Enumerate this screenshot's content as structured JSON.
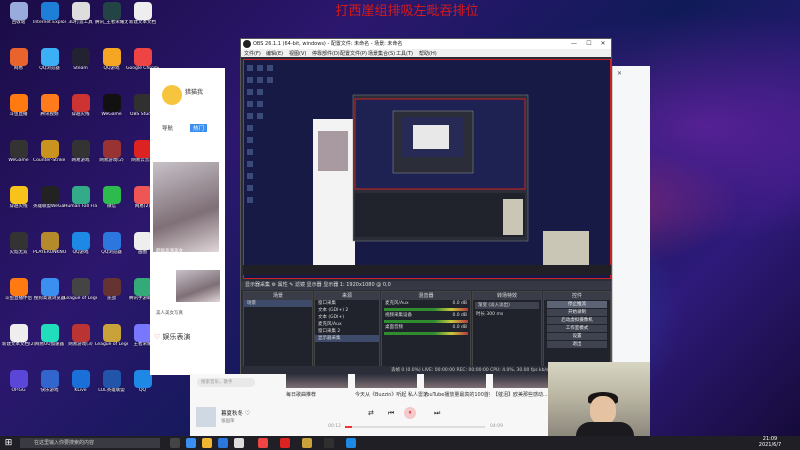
{
  "overlay_title": "打西崖组排吸左毗吞排位",
  "desktop_icons": [
    {
      "label": "回收站",
      "color": "#9ad"
    },
    {
      "label": "Internet Explorer",
      "color": "#1e7fd8"
    },
    {
      "label": "3D打造工具",
      "color": "#ddd"
    },
    {
      "label": "腾讯_王者荣耀无限火力",
      "color": "#244"
    },
    {
      "label": "新建文本文档",
      "color": "#eee"
    },
    {
      "label": "网易",
      "color": "#e8642c"
    },
    {
      "label": "QQ浏览器",
      "color": "#3bb0f6"
    },
    {
      "label": "Steam",
      "color": "#223"
    },
    {
      "label": "QQ游戏",
      "color": "#f5a623"
    },
    {
      "label": "Google Chrome",
      "color": "#e44"
    },
    {
      "label": "斗鱼直播",
      "color": "#ff7a10"
    },
    {
      "label": "腾讯视频",
      "color": "#ff7b1c"
    },
    {
      "label": "穿越火线",
      "color": "#c33"
    },
    {
      "label": "WeGame",
      "color": "#111"
    },
    {
      "label": "OBS Studio",
      "color": "#303030"
    },
    {
      "label": "WeGame",
      "color": "#333"
    },
    {
      "label": "Counter-Strike Global Off...",
      "color": "#c8931f"
    },
    {
      "label": "网易游戏",
      "color": "#333"
    },
    {
      "label": "网易游戏(2)",
      "color": "#933"
    },
    {
      "label": "网易云音乐",
      "color": "#d22"
    },
    {
      "label": "穿越火线",
      "color": "#f7c31a"
    },
    {
      "label": "英雄联盟WeGame版",
      "color": "#222"
    },
    {
      "label": "Human Fall Flat",
      "color": "#3a8"
    },
    {
      "label": "微信",
      "color": "#2dbb4e"
    },
    {
      "label": "网易(2)",
      "color": "#e55"
    },
    {
      "label": "火焰无双",
      "color": "#333"
    },
    {
      "label": "PLAYERUNKNOWN'S BATTLEGR...",
      "color": "#b58a2c"
    },
    {
      "label": "QQ游戏",
      "color": "#1e88e5"
    },
    {
      "label": "QQ浏览器",
      "color": "#2c77dd"
    },
    {
      "label": "画图",
      "color": "#eee"
    },
    {
      "label": "斗鱼直播伴侣",
      "color": "#ff7a10"
    },
    {
      "label": "搜狗高速浏览器",
      "color": "#3a8ff0"
    },
    {
      "label": "League of Legends",
      "color": "#444"
    },
    {
      "label": "逆战",
      "color": "#633"
    },
    {
      "label": "腾讯手游助手",
      "color": "#3a7"
    },
    {
      "label": "新建文本文档(2)",
      "color": "#eee"
    },
    {
      "label": "网易UU加速器",
      "color": "#2db"
    },
    {
      "label": "网易游戏(3)",
      "color": "#b33"
    },
    {
      "label": "League of Legends",
      "color": "#c9a33a"
    },
    {
      "label": "王者荣耀",
      "color": "#77f"
    },
    {
      "label": "OP.GG",
      "color": "#5a47d8"
    },
    {
      "label": "快乐游戏",
      "color": "#36c"
    },
    {
      "label": "KLive",
      "color": "#1b6fd8"
    },
    {
      "label": "LOL英雄联盟",
      "color": "#25a"
    },
    {
      "label": "QQ",
      "color": "#1e88e5"
    }
  ],
  "browser_left": {
    "site_name": "猎猫我",
    "tabs": [
      "导航",
      "热门"
    ],
    "captions": [
      "超级高清美女",
      "超级高清",
      "美人美女写真"
    ],
    "section": "娱乐表演"
  },
  "obs": {
    "title": "OBS 26.1.1 (64-bit, windows) - 配置文件: 未命名 - 场景: 未命名",
    "window_controls": [
      "—",
      "☐",
      "✕"
    ],
    "menu": [
      "文件(F)",
      "编辑(E)",
      "视图(V)",
      "停靠部件(D)",
      "配置文件(P)",
      "场景集合(S)",
      "工具(T)",
      "帮助(H)"
    ],
    "status_bar": "显示器采集  ⚙ 属性  ✎ 滤镜  显示器  显示器 1: 1920x1080 @ 0,0",
    "docks": {
      "scenes": {
        "header": "场景",
        "items": [
          "场景"
        ]
      },
      "sources": {
        "header": "来源",
        "items": [
          "窗口采集",
          "文本 (GDI+) 2",
          "文本 (GDI+)",
          "麦克风/Aux",
          "窗口采集 2",
          "显示器采集"
        ]
      },
      "mixer": {
        "header": "混音器",
        "items": [
          "麦克风/Aux",
          "视频采集设备",
          "桌面音频"
        ],
        "values": [
          "0.0 dB",
          "0.0 dB",
          "0.0 dB"
        ]
      },
      "transitions": {
        "header": "转场特效",
        "mode": "渐变 (淡入淡出)",
        "duration": "时长 300 ms"
      },
      "controls": {
        "header": "控件",
        "buttons": [
          "停止推流",
          "开始录制",
          "启动虚拟摄像机",
          "工作室模式",
          "设置",
          "退出"
        ]
      }
    },
    "footer": "丢帧 0 (0.0%)   LIVE: 00:00:00   REC: 00:00:00   CPU: 4.0%, 30.00 fps   kb/s: 2450"
  },
  "music": {
    "search_placeholder": "搜索音乐，歌手",
    "cards": [
      "每日歌曲推荐",
      "今天从《Buzzin》听起 私人雷达",
      "YouTube播放量最高的100首英文歌曲",
      "【催泪】欧美那些感动..."
    ],
    "song": "暮夏秋冬",
    "artist": "张国荣",
    "controls": [
      "⇄",
      "⏮",
      "⏸",
      "⏭",
      "♡"
    ],
    "time_elapsed": "00:12",
    "time_total": "04:09",
    "progress": 0.05
  },
  "taskbar": {
    "start": "⊞",
    "search_placeholder": "在这里输入你要搜索的内容",
    "time": "21:09",
    "date": "2021/6/7"
  }
}
